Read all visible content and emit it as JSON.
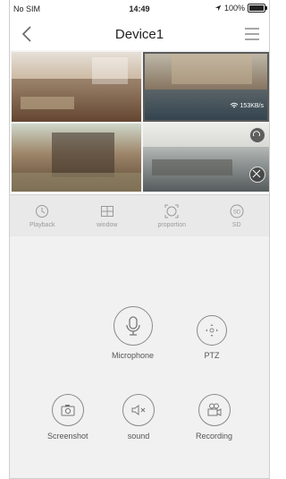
{
  "status_bar": {
    "carrier": "No SIM",
    "time": "14:49",
    "battery": "100%"
  },
  "nav": {
    "title": "Device1"
  },
  "video": {
    "speed": "153KB/s"
  },
  "toolbar": {
    "items": [
      {
        "label": "Playback",
        "icon": "history-icon"
      },
      {
        "label": "window",
        "icon": "grid-icon"
      },
      {
        "label": "proportion",
        "icon": "proportion-icon"
      },
      {
        "label": "SD",
        "icon": "sd-icon"
      }
    ]
  },
  "controls": {
    "microphone": "Microphone",
    "ptz": "PTZ",
    "screenshot": "Screenshot",
    "sound": "sound",
    "recording": "Recording"
  }
}
